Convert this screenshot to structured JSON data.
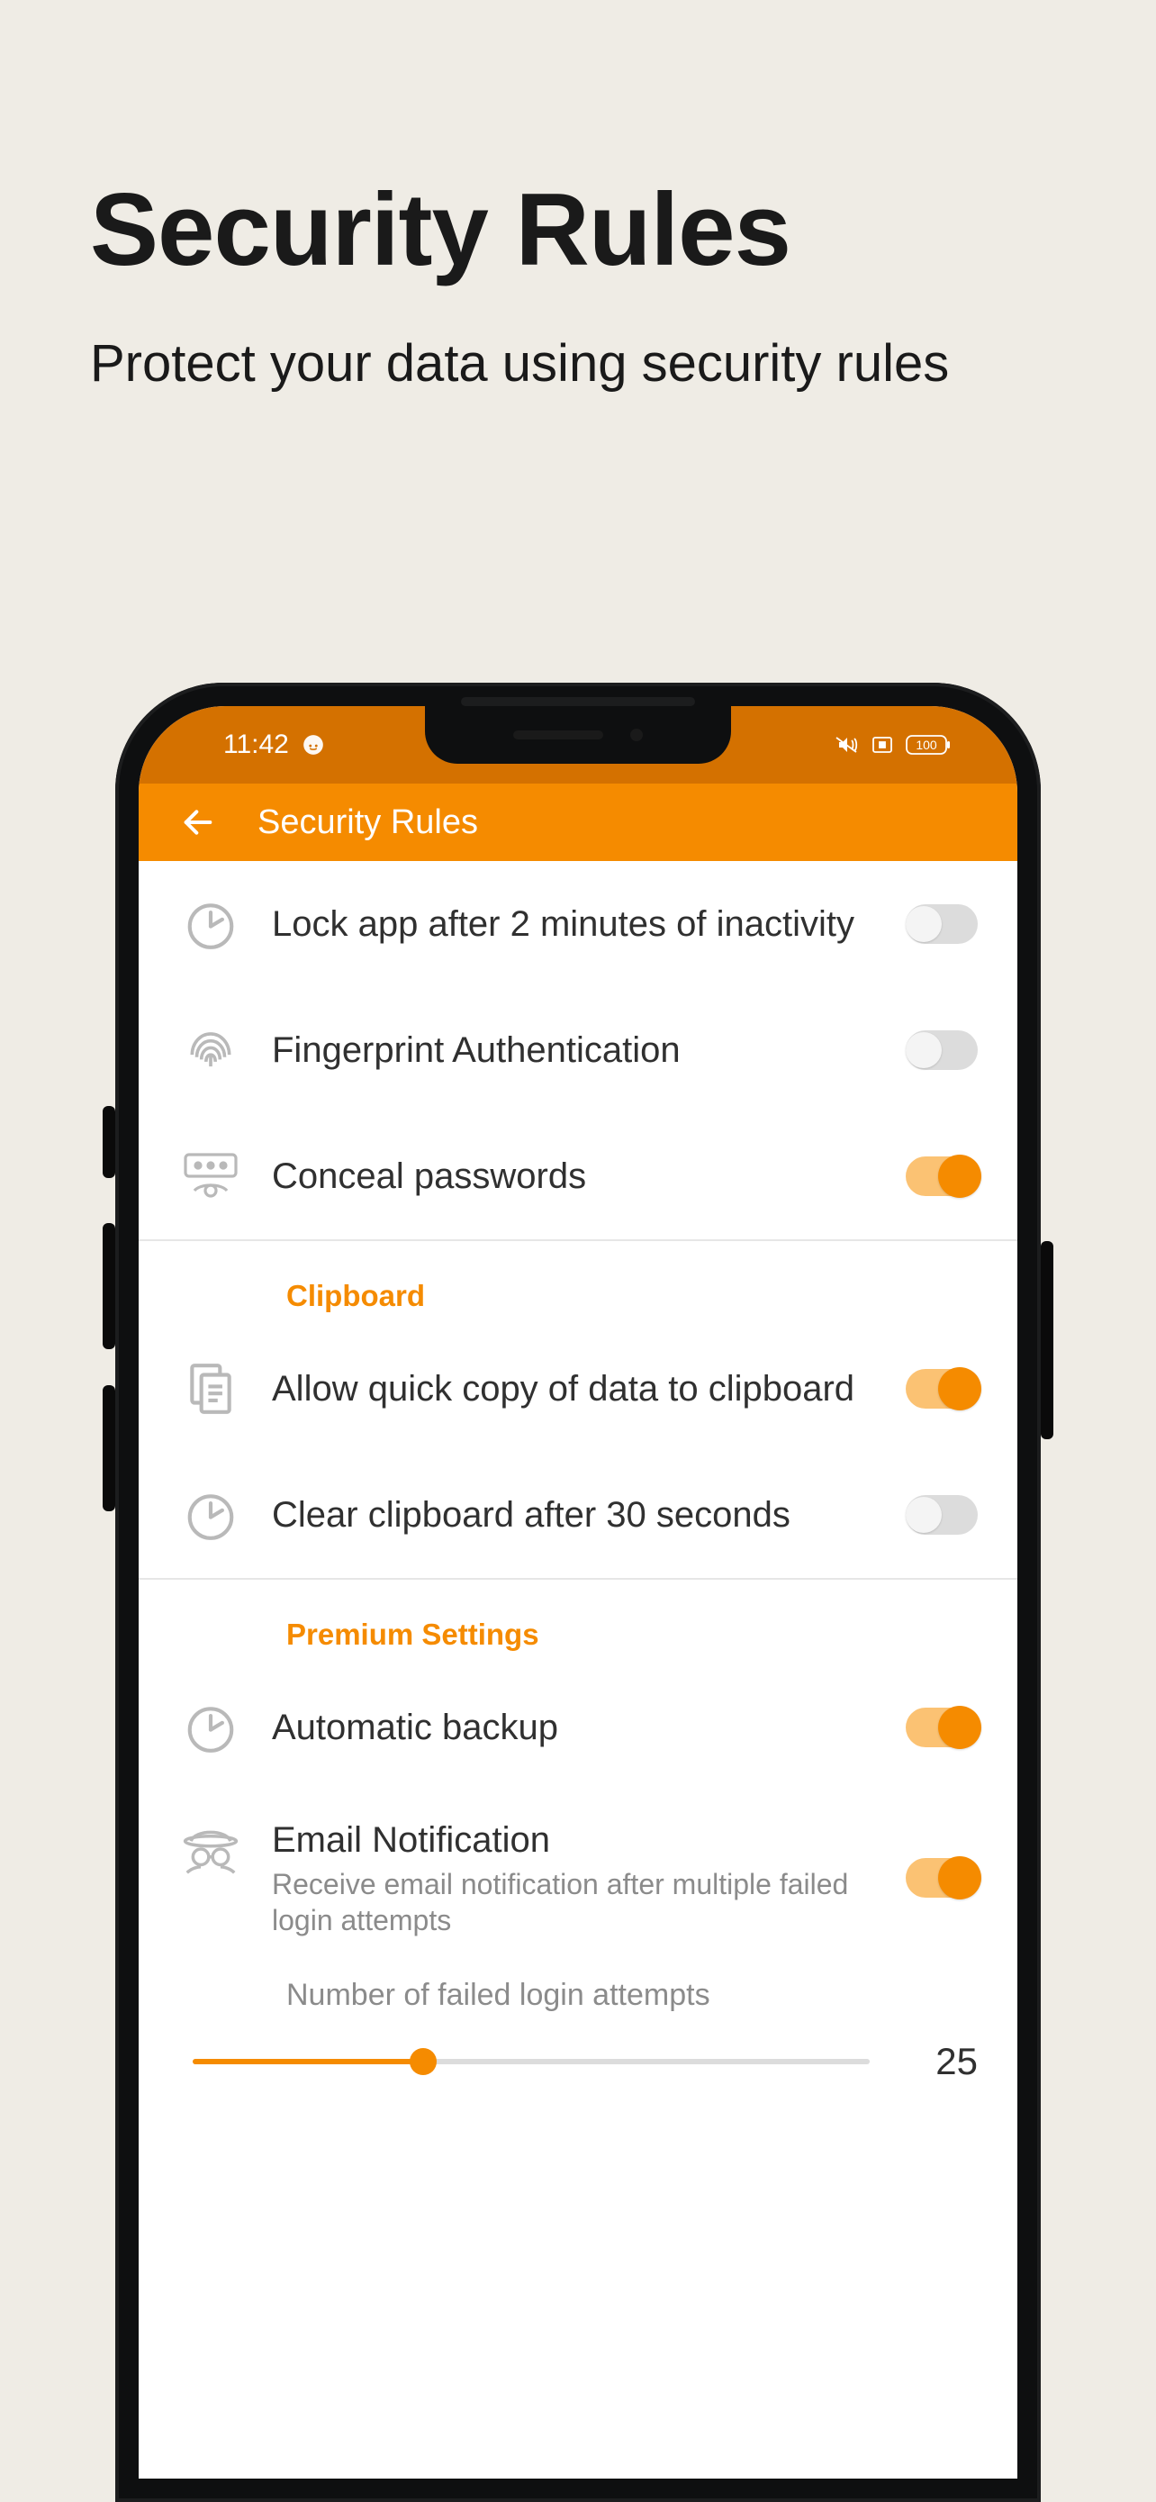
{
  "promo": {
    "title": "Security Rules",
    "subtitle": "Protect your data using security rules"
  },
  "status": {
    "time": "11:42",
    "battery_label": "100"
  },
  "appbar": {
    "title": "Security Rules"
  },
  "settings": {
    "lock_app": {
      "label": "Lock app after 2 minutes of inactivity",
      "on": false
    },
    "fingerprint": {
      "label": "Fingerprint Authentication",
      "on": false
    },
    "conceal": {
      "label": "Conceal passwords",
      "on": true
    },
    "clipboard_header": "Clipboard",
    "quick_copy": {
      "label": "Allow quick copy of data to clipboard",
      "on": true
    },
    "clear_clip": {
      "label": "Clear clipboard after 30 seconds",
      "on": false
    },
    "premium_header": "Premium Settings",
    "backup": {
      "label": "Automatic backup",
      "on": true
    },
    "email_notif": {
      "label": "Email Notification",
      "sub": "Receive email notification after multiple failed login attempts",
      "on": true
    },
    "slider": {
      "label": "Number of failed login attempts",
      "value": "25",
      "percent": 34
    }
  }
}
